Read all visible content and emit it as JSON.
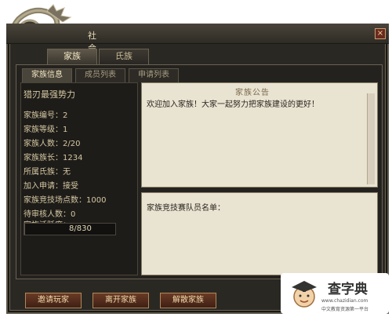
{
  "window": {
    "title": "社 会",
    "close_label": "×"
  },
  "main_tabs": [
    {
      "label": "家族"
    },
    {
      "label": "氏族"
    }
  ],
  "sub_tabs": [
    {
      "label": "家族信息"
    },
    {
      "label": "成员列表"
    },
    {
      "label": "申请列表"
    }
  ],
  "family_info": {
    "name": "猎刃最强势力",
    "lines": [
      "家族编号：2",
      "家族等级：1",
      "家族人数：2/20",
      "家族族长：1234",
      "所属氏族：无",
      "加入申请：接受",
      "家族竞技场点数：1000",
      "待审核人数：0",
      "家族活跃度："
    ],
    "activity_text": "8/830",
    "activity_fraction": 0.0096
  },
  "notice": {
    "title": "家族公告",
    "body": "欢迎加入家族！大家一起努力把家族建设的更好！"
  },
  "roster": {
    "label": "家族竞技赛队员名单："
  },
  "buttons": {
    "invite": "邀请玩家",
    "leave": "离开家族",
    "disband": "解散家族"
  },
  "watermark": {
    "text": "查字典",
    "url": "www.chazidian.com",
    "sub": "中文教育资源第一平台"
  },
  "colors": {
    "panel_bg": "#2a2823",
    "parchment": "#e9e3d2",
    "button": "#6a3a24"
  }
}
